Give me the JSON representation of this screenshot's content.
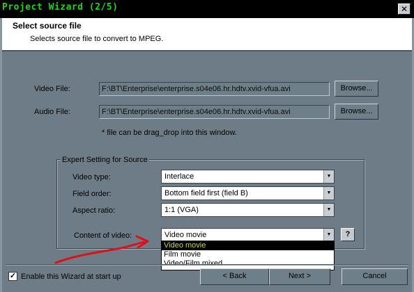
{
  "window": {
    "title": "Project Wizard (2/5)",
    "close_label": "✕"
  },
  "header": {
    "title": "Select source file",
    "subtitle": "Selects source file to convert to MPEG."
  },
  "source": {
    "video_label": "Video File:",
    "video_value": "F:\\BT\\Enterprise\\enterprise.s04e06.hr.hdtv.xvid-vfua.avi",
    "audio_label": "Audio File:",
    "audio_value": "F:\\BT\\Enterprise\\enterprise.s04e06.hr.hdtv.xvid-vfua.avi",
    "browse_label": "Browse...",
    "hint": "* file can be drag_drop into this window."
  },
  "expert": {
    "group_title": "Expert Setting for Source",
    "video_type_label": "Video type:",
    "video_type_value": "Interlace",
    "field_order_label": "Field order:",
    "field_order_value": "Bottom field first (field B)",
    "aspect_label": "Aspect ratio:",
    "aspect_value": "1:1 (VGA)",
    "content_label": "Content of video:",
    "content_value": "Video movie",
    "content_options": [
      "Video movie",
      "Film movie",
      "Video/Film mixed"
    ],
    "help_label": "?"
  },
  "footer": {
    "enable_label": "Enable this Wizard at start up",
    "enable_checked": true,
    "back_label": "< Back",
    "next_label": "Next >",
    "cancel_label": "Cancel"
  },
  "colors": {
    "title_text": "#1fd61f",
    "background": "#6d7c87",
    "annotation": "#e0101a"
  }
}
